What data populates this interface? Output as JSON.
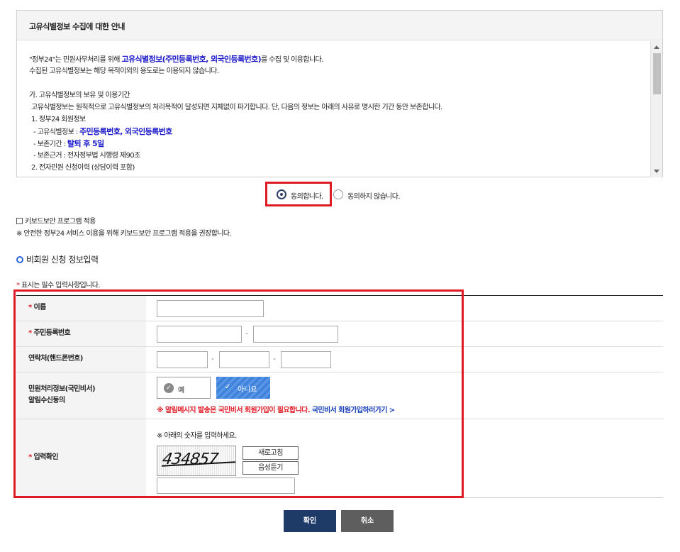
{
  "notice": {
    "title": "고유식별정보 수집에 대한 안내",
    "line1_pre": "\"정부24\"는 민원사무처리를 위해 ",
    "line1_hl": "고유식별정보(주민등록번호, 외국인등록번호)",
    "line1_post": "를 수집 및 이용합니다.",
    "line2": "수집된 고유식별정보는 해당 목적이외의 용도로는 이용되지 않습니다.",
    "section_a": "가. 고유식별정보의 보유 및 이용기간",
    "section_a_desc": "고유식별정보는 원칙적으로 고유식별정보의 처리목적이 달성되면 지체없이 파기합니다. 단, 다음의 정보는 아래의 사유로 명시한 기간 동안 보존합니다.",
    "item1": "1. 정부24 회원정보",
    "item1_a_label": "- 고유식별정보 : ",
    "item1_a_value": "주민등록번호, 외국인등록번호",
    "item1_b_label": "- 보존기간 : ",
    "item1_b_value": "탈퇴 후 5일",
    "item1_c": "- 보존근거 : 전자정부법 시행령 제90조",
    "item2": "2. 전자민원 신청이력 (상담이력 포함)"
  },
  "consent": {
    "agree_label": "동의합니다.",
    "disagree_label": "동의하지 않습니다."
  },
  "keyboard": {
    "label": "키보드보안 프로그램 적용",
    "note": "※ 안전한 정부24 서비스 이용을 위해 키보드보안 프로그램 적용을 권장합니다."
  },
  "section": {
    "title": "비회원 신청 정보입력",
    "required_note": "표시는 필수 입력사항입니다.",
    "required_mark": "*"
  },
  "form": {
    "name_label": "이름",
    "rrn_label": "주민등록번호",
    "phone_label": "연락처(핸드폰번호)",
    "notify_label_1": "민원처리정보(국민비서)",
    "notify_label_2": "알림수신동의",
    "notify_yes": "예",
    "notify_no": "아니요",
    "notify_alert": "※ 알림메시지 발송은 국민비서 회원가입이 필요합니다.",
    "notify_link": "국민비서 회원가입하러가기 >",
    "captcha_label": "입력확인",
    "captcha_note": "※ 아래의 숫자를 입력하세요.",
    "captcha_value": "434857",
    "refresh_label": "새로고침",
    "audio_label": "음성듣기",
    "dash": "-"
  },
  "actions": {
    "ok_label": "확인",
    "cancel_label": "취소"
  },
  "colors": {
    "accent_red": "#e01a24",
    "link_blue": "#1a17c9",
    "ok_navy": "#1e3a66",
    "cancel_gray": "#5e5e5e"
  }
}
